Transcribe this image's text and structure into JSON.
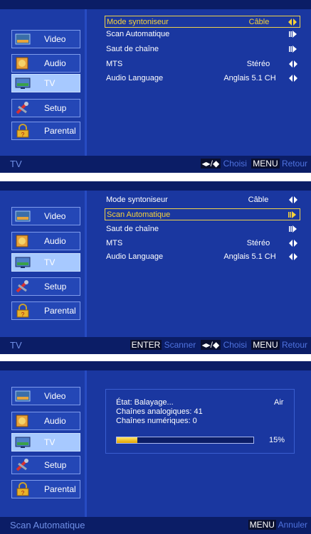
{
  "sidebar": {
    "items": [
      {
        "label": "Video",
        "icon": "video-icon"
      },
      {
        "label": "Audio",
        "icon": "audio-icon"
      },
      {
        "label": "TV",
        "icon": "tv-icon",
        "active": true
      },
      {
        "label": "Setup",
        "icon": "setup-icon"
      },
      {
        "label": "Parental",
        "icon": "parental-icon"
      }
    ]
  },
  "screen1": {
    "footer_title": "TV",
    "menu": [
      {
        "label": "Mode syntoniseur",
        "value": "Câble",
        "arrow": "left-right",
        "selected": true
      },
      {
        "label": "Scan Automatique",
        "value": "",
        "arrow": "enter"
      },
      {
        "label": "Saut de chaîne",
        "value": "",
        "arrow": "enter"
      },
      {
        "label": "MTS",
        "value": "Stéréo",
        "arrow": "left-right"
      },
      {
        "label": "Audio Language",
        "value": "Anglais 5.1 CH",
        "arrow": "left-right"
      }
    ],
    "footer": {
      "nav_keys": "◂▸/◆",
      "nav_hint": "Choisi",
      "menu_key": "MENU",
      "menu_hint": "Retour"
    }
  },
  "screen2": {
    "footer_title": "TV",
    "menu": [
      {
        "label": "Mode syntoniseur",
        "value": "Câble",
        "arrow": "left-right"
      },
      {
        "label": "Scan Automatique",
        "value": "",
        "arrow": "enter",
        "selected": true
      },
      {
        "label": "Saut de chaîne",
        "value": "",
        "arrow": "enter"
      },
      {
        "label": "MTS",
        "value": "Stéréo",
        "arrow": "left-right"
      },
      {
        "label": "Audio Language",
        "value": "Anglais 5.1 CH",
        "arrow": "left-right"
      }
    ],
    "footer": {
      "enter_key": "ENTER",
      "enter_hint": "Scanner",
      "nav_keys": "◂▸/◆",
      "nav_hint": "Choisi",
      "menu_key": "MENU",
      "menu_hint": "Retour"
    }
  },
  "screen3": {
    "footer_title": "Scan Automatique",
    "scan": {
      "status": "État: Balayage...",
      "source": "Air",
      "analog": "Chaînes analogiques: 41",
      "digital": "Chaînes numériques: 0",
      "percent_label": "15%",
      "progress": 0.15
    },
    "footer": {
      "menu_key": "MENU",
      "menu_hint": "Annuler"
    }
  },
  "colors": {
    "panel": "#142a78",
    "sidebar": "#1c3ba6",
    "highlight": "#f7d23a",
    "statusbar": "#0b1d66"
  }
}
